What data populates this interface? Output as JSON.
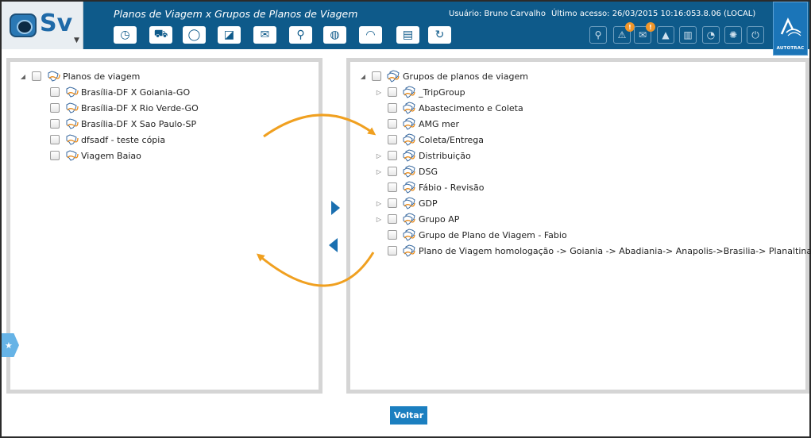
{
  "app": {
    "logo_text": "Sv",
    "title": "Planos de Viagem x Grupos de Planos de Viagem",
    "user_label": "Usuário: Bruno Carvalho",
    "last_access": "Último acesso: 26/03/2015 10:16:05",
    "version": "3.8.06 (LOCAL)",
    "brand_name": "AUTOTRAC"
  },
  "toolbar": {
    "items": [
      {
        "icon": "clock-icon",
        "glyph": "◷"
      },
      {
        "icon": "truck-icon",
        "glyph": "⛟"
      },
      {
        "icon": "search-location-icon",
        "glyph": "◯"
      },
      {
        "icon": "eraser-icon",
        "glyph": "◪"
      },
      {
        "icon": "mail-icon",
        "glyph": "✉"
      },
      {
        "icon": "person-icon",
        "glyph": "⚲"
      },
      {
        "icon": "globe-icon",
        "glyph": "◍"
      },
      {
        "icon": "signal-icon",
        "glyph": "◠"
      },
      {
        "icon": "cards-icon",
        "glyph": "▤"
      },
      {
        "icon": "refresh-icon",
        "glyph": "↻"
      }
    ],
    "right_items": [
      {
        "icon": "search-icon",
        "glyph": "⚲",
        "badge": ""
      },
      {
        "icon": "alert-icon",
        "glyph": "⚠",
        "badge": "!"
      },
      {
        "icon": "messages-icon",
        "glyph": "✉",
        "badge": "!"
      },
      {
        "icon": "graduation-icon",
        "glyph": "▲",
        "badge": ""
      },
      {
        "icon": "book-icon",
        "glyph": "▥",
        "badge": ""
      },
      {
        "icon": "chat-icon",
        "glyph": "◔",
        "badge": ""
      },
      {
        "icon": "help-icon",
        "glyph": "✺",
        "badge": ""
      },
      {
        "icon": "power-icon",
        "glyph": "⏻",
        "badge": ""
      }
    ]
  },
  "left_tree": {
    "root": "Planos de viagem",
    "items": [
      "Brasília-DF X Goiania-GO",
      "Brasília-DF X Rio Verde-GO",
      "Brasília-DF X Sao Paulo-SP",
      "dfsadf - teste cópia",
      "Viagem Baiao"
    ]
  },
  "right_tree": {
    "root": "Grupos de planos de viagem",
    "items": [
      {
        "label": "_TripGroup",
        "expandable": true
      },
      {
        "label": "Abastecimento e Coleta",
        "expandable": false
      },
      {
        "label": "AMG mer",
        "expandable": false
      },
      {
        "label": "Coleta/Entrega",
        "expandable": false
      },
      {
        "label": "Distribuição",
        "expandable": true
      },
      {
        "label": "DSG",
        "expandable": true
      },
      {
        "label": "Fábio - Revisão",
        "expandable": false
      },
      {
        "label": "GDP",
        "expandable": true
      },
      {
        "label": "Grupo AP",
        "expandable": true
      },
      {
        "label": "Grupo de Plano de Viagem - Fabio",
        "expandable": false
      },
      {
        "label": "Plano de Viagem homologação -> Goiania -> Abadiania-> Anapolis->Brasilia-> Planaltina",
        "expandable": false
      }
    ]
  },
  "buttons": {
    "back_label": "Voltar"
  },
  "colors": {
    "header_bg": "#0e5a8a",
    "accent": "#1b7fc0",
    "arrow_blue": "#1a6fb0",
    "annotation_orange": "#f0a020"
  }
}
